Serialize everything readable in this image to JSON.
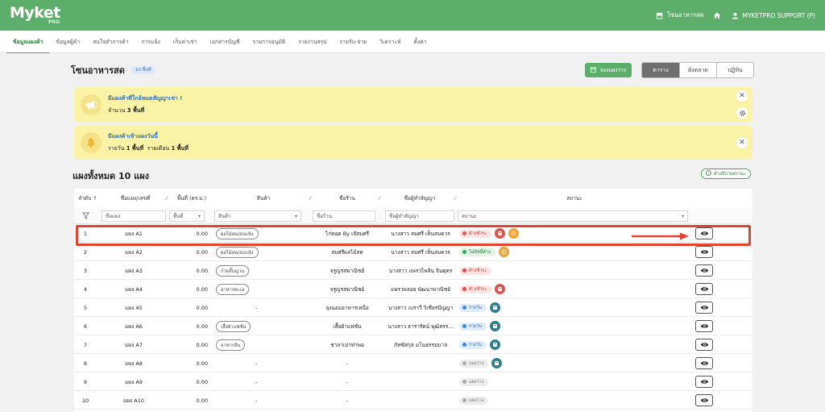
{
  "app": {
    "brand": "Myket",
    "brand_sub": "PRO"
  },
  "topbar": {
    "market": "โซนอาหารสด",
    "user": "MYKETPRO SUPPORT (P)"
  },
  "nav": {
    "items": [
      "ข้อมูลแผงค้า",
      "ข้อมูลผู้ค้า",
      "สนใจทำการค้า",
      "การแจ้ง",
      "เก็บค่าเช่า",
      "เอกสารบัญชี",
      "รายการอนุมัติ",
      "รายงานสรุป",
      "รายรับ-จ่าย",
      "วิเคราะห์",
      "ตั้งค่า"
    ],
    "active_index": 0
  },
  "page": {
    "title": "โซนอาหารสด",
    "badge": "10 พื้นที่",
    "book_button": "จองแผงว่าง",
    "views": [
      "ตาราง",
      "ผังตลาด",
      "ปฏิทิน"
    ],
    "active_view": 0
  },
  "alerts": [
    {
      "title": "มีแผงค้าที่ใกล้หมดสัญญาเช่า !",
      "sub_prefix": "จำนวน",
      "sub_bold": "3 พื้นที่",
      "icon": "megaphone-icon"
    },
    {
      "title": "มีแผงค้าเข้าแผงวันนี้",
      "sub_prefix": "รายวัน",
      "sub_bold": "1 พื้นที่",
      "sub_prefix2": "รายเดือน",
      "sub_bold2": "1 พื้นที่",
      "icon": "bell-icon"
    }
  ],
  "section": {
    "title": "แผงทั้งหมด 10 แผง",
    "desc_button": "คำอธิบายสถานะ"
  },
  "table": {
    "headers": [
      "ลำดับ",
      "ชื่อแผง/เลขที่",
      "พื้นที่ (ตร.ม.)",
      "สินค้า",
      "ชื่อร้าน",
      "ชื่อผู้ทำสัญญา",
      "สถานะ"
    ],
    "filters": [
      "ชื่อแผง",
      "พื้นที่",
      "สินค้า",
      "ชื่อร้าน",
      "ชื่อผู้ทำสัญญา",
      "สถานะ"
    ],
    "rows": [
      {
        "no": "1",
        "name": "แผง A1",
        "area": "0.00",
        "product": "ผลไม้สด/อบแห้ง",
        "shop": "ไก่ทอด By เจ๊สมศรี",
        "contract": "นางสาว สมศรี เห็นสมควร",
        "status": "ค้างชำระ",
        "status_kind": "red",
        "icons": [
          "red",
          "orange"
        ]
      },
      {
        "no": "2",
        "name": "แผง A2",
        "area": "0.00",
        "product": "ผลไม้สด/อบแห้ง",
        "shop": "สมศรีผลไม้สด",
        "contract": "นางสาว สมศรี เห็นสมควร",
        "status": "ไม่มีหนี้ค้าง",
        "status_kind": "green",
        "icons": [
          "orange"
        ]
      },
      {
        "no": "3",
        "name": "แผง A3",
        "area": "0.00",
        "product": "ก๋วยจั๊บญวน",
        "shop": "จรูญรสพาณิชย์",
        "contract": "นางสาว แพรวไพลิน จินตุตร",
        "status": "ค้างชำระ",
        "status_kind": "red",
        "icons": []
      },
      {
        "no": "4",
        "name": "แผง A4",
        "area": "0.00",
        "product": "อาหารทะเล",
        "shop": "จรูญรสพาณิชย์",
        "contract": "แพรวพลอย พัฒนาพาณิชย์",
        "status": "ค้างชำระ",
        "status_kind": "red",
        "icons": [
          "red"
        ]
      },
      {
        "no": "5",
        "name": "แผง A5",
        "area": "0.00",
        "product": "-",
        "shop": "ลุงนอมอาหารเหนือ",
        "contract": "นางสาว เบราวี วิเชียรปัญญา",
        "status": "รายวัน",
        "status_kind": "blue",
        "icons": [
          "teal"
        ]
      },
      {
        "no": "6",
        "name": "แผง A6",
        "area": "0.00",
        "product": "เสื้อผ้าแฟชั่น",
        "shop": "เสื้อผ้าแฟชั่น",
        "contract": "นางสาว ธารารัตน์ พุฒิสรร...",
        "status": "รายวัน",
        "status_kind": "blue",
        "icons": [
          "teal"
        ]
      },
      {
        "no": "7",
        "name": "แผง A7",
        "area": "0.00",
        "product": "อาหารจีน",
        "shop": "ชาลาเปาท่าพอ",
        "contract": "ภัทซ์สกุล มโนธรรมบาล",
        "status": "รายวัน",
        "status_kind": "blue",
        "icons": [
          "teal"
        ]
      },
      {
        "no": "8",
        "name": "แผง A8",
        "area": "0.00",
        "product": "-",
        "shop": "-",
        "contract": "",
        "status": "แผงว่าง",
        "status_kind": "gray",
        "icons": [
          "teal"
        ]
      },
      {
        "no": "9",
        "name": "แผง A9",
        "area": "0.00",
        "product": "-",
        "shop": "-",
        "contract": "",
        "status": "แผงว่าง",
        "status_kind": "gray",
        "icons": []
      },
      {
        "no": "10",
        "name": "แผง A10",
        "area": "0.00",
        "product": "-",
        "shop": "-",
        "contract": "",
        "status": "แผงว่าง",
        "status_kind": "gray",
        "icons": []
      }
    ]
  },
  "colors": {
    "brand_green": "#5cae6a",
    "alert_yellow": "#faf3a6",
    "highlight_red": "#e2432f"
  }
}
